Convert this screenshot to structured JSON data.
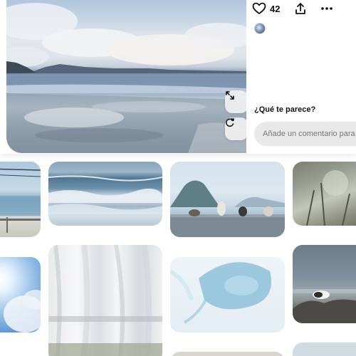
{
  "pin": {
    "like_count": "42",
    "comment_prompt": "¿Qué te parece?",
    "comment_placeholder": "Añade un comentario para i",
    "icons": {
      "like": "heart-icon",
      "share": "share-icon",
      "more": "more-icon",
      "expand": "expand-icon",
      "visual_search": "visual-search-icon"
    }
  },
  "grid": {
    "tiles": [
      {
        "subject": "coastal-railing-sea"
      },
      {
        "subject": "ocean-waves"
      },
      {
        "subject": "cats-on-seawall"
      },
      {
        "subject": "grasses-bokeh"
      },
      {
        "subject": "sun-clouds-sky"
      },
      {
        "subject": "sheer-curtain"
      },
      {
        "subject": "jellyfish"
      },
      {
        "subject": "cat-on-rocks-sea"
      }
    ]
  },
  "colors": {
    "comment_field": "#e9e9e9",
    "text": "#111111",
    "placeholder": "#767676"
  }
}
